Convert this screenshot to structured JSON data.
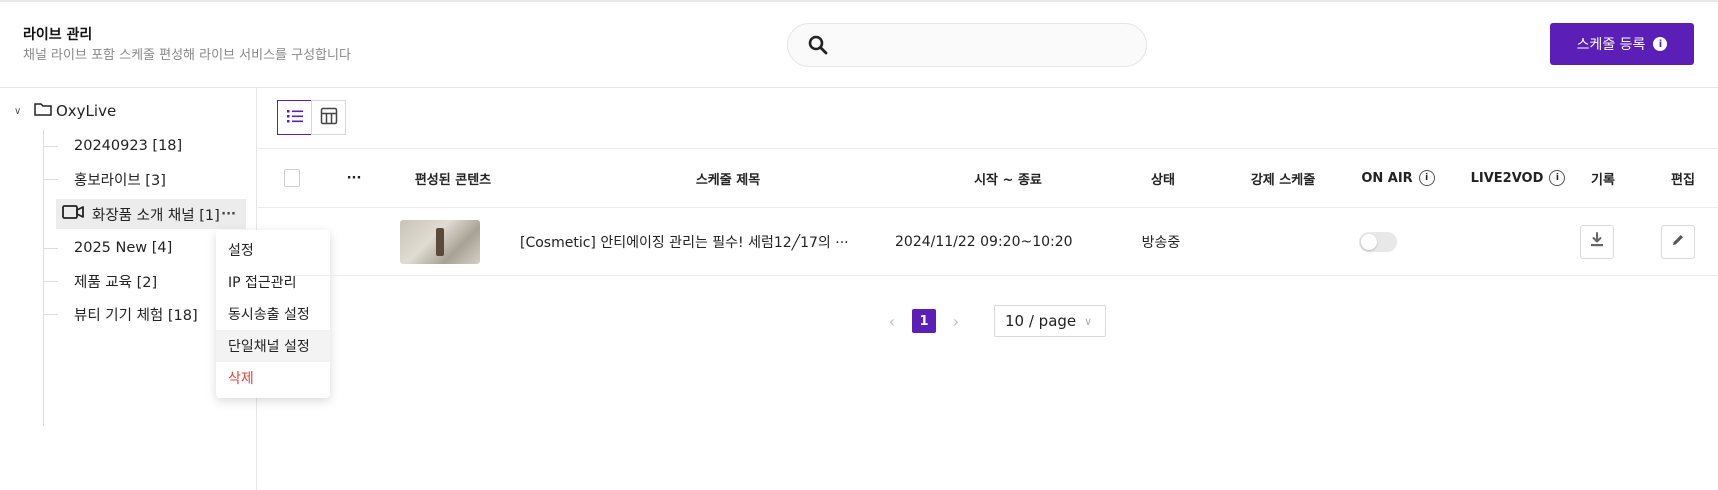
{
  "header": {
    "title": "라이브 관리",
    "subtitle": "채널 라이브 포함 스케줄 편성해 라이브 서비스를 구성합니다",
    "search_placeholder": "",
    "schedule_button": "스케줄 등록"
  },
  "sidebar": {
    "root": "OxyLive",
    "items": [
      {
        "label": "20240923 [18]"
      },
      {
        "label": "홍보라이브 [3]"
      },
      {
        "label": "화장품 소개 채널 [1]"
      },
      {
        "label": "2025 New [4]"
      },
      {
        "label": "제품 교육 [2]"
      },
      {
        "label": "뷰티 기기 체험 [18]"
      }
    ],
    "more": "···"
  },
  "context_menu": {
    "items": [
      {
        "label": "설정"
      },
      {
        "label": "IP 접근관리"
      },
      {
        "label": "동시송출 설정"
      },
      {
        "label": "단일채널 설정"
      },
      {
        "label": "삭제"
      }
    ]
  },
  "table": {
    "headers": {
      "more": "···",
      "content": "편성된 콘텐츠",
      "title": "스케줄 제목",
      "time": "시작 ~ 종료",
      "status": "상태",
      "forced": "강제 스케줄",
      "onair": "ON AIR",
      "live2vod": "LIVE2VOD",
      "record": "기록",
      "edit": "편집"
    },
    "rows": [
      {
        "title": "[Cosmetic] 안티에이징 관리는 필수! 세럼12╱17의 ···",
        "time": "2024/11/22 09:20~10:20",
        "status": "방송중",
        "onair": false
      }
    ]
  },
  "pagination": {
    "current": "1",
    "page_size": "10 / page"
  },
  "colors": {
    "accent": "#5b1fb8",
    "danger": "#e0443a"
  }
}
